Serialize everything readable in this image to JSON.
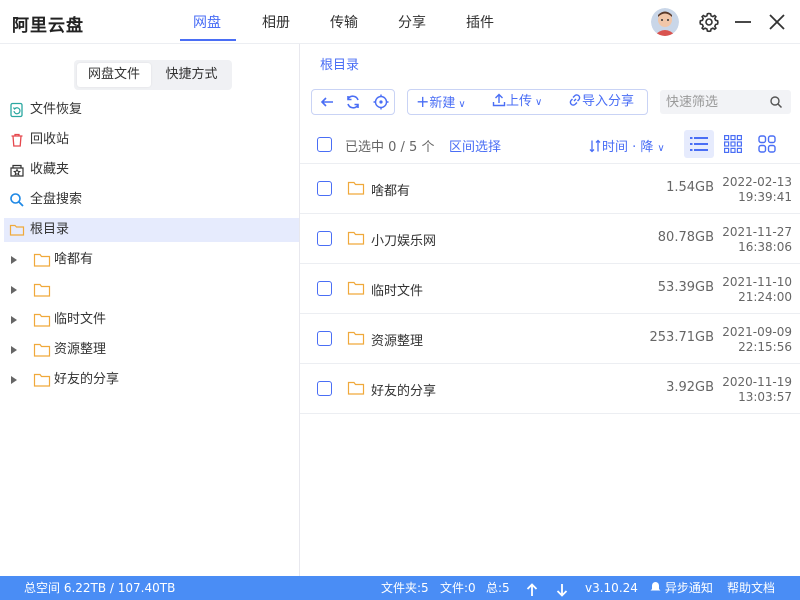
{
  "app": {
    "title": "阿里云盘"
  },
  "nav": {
    "tabs": [
      {
        "label": "网盘",
        "active": true
      },
      {
        "label": "相册"
      },
      {
        "label": "传输"
      },
      {
        "label": "分享"
      },
      {
        "label": "插件"
      }
    ]
  },
  "sidebar": {
    "segments": [
      "网盘文件",
      "快捷方式"
    ],
    "items": [
      {
        "label": "文件恢复",
        "icon": "file-restore-icon"
      },
      {
        "label": "回收站",
        "icon": "trash-icon"
      },
      {
        "label": "收藏夹",
        "icon": "favorites-icon"
      },
      {
        "label": "全盘搜索",
        "icon": "search-icon"
      },
      {
        "label": "根目录",
        "icon": "folder-icon"
      }
    ],
    "tree": [
      {
        "label": "啥都有"
      },
      {
        "label": ""
      },
      {
        "label": "临时文件"
      },
      {
        "label": "资源整理"
      },
      {
        "label": "好友的分享"
      }
    ]
  },
  "main": {
    "breadcrumb": "根目录",
    "toolbar": {
      "new_label": "新建",
      "upload_label": "上传",
      "import_label": "导入分享",
      "filter_placeholder": "快速筛选"
    },
    "header": {
      "selected": "已选中 0 / 5 个",
      "range_select": "区间选择",
      "sort": "时间 · 降"
    },
    "rows": [
      {
        "name": "啥都有",
        "size": "1.54GB",
        "date": "2022-02-13",
        "time": "19:39:41"
      },
      {
        "name": "小刀娱乐网",
        "size": "80.78GB",
        "date": "2021-11-27",
        "time": "16:38:06"
      },
      {
        "name": "临时文件",
        "size": "53.39GB",
        "date": "2021-11-10",
        "time": "21:24:00"
      },
      {
        "name": "资源整理",
        "size": "253.71GB",
        "date": "2021-09-09",
        "time": "22:15:56"
      },
      {
        "name": "好友的分享",
        "size": "3.92GB",
        "date": "2020-11-19",
        "time": "13:03:57"
      }
    ]
  },
  "status": {
    "space": "总空间 6.22TB / 107.40TB",
    "folders": "文件夹:5",
    "files": "文件:0",
    "total": "总:5",
    "version": "v3.10.24",
    "notify": "异步通知",
    "help": "帮助文档"
  },
  "colors": {
    "accent": "#4a6ef5",
    "folder": "#f7c35c",
    "statusbar": "#4a8df5"
  }
}
